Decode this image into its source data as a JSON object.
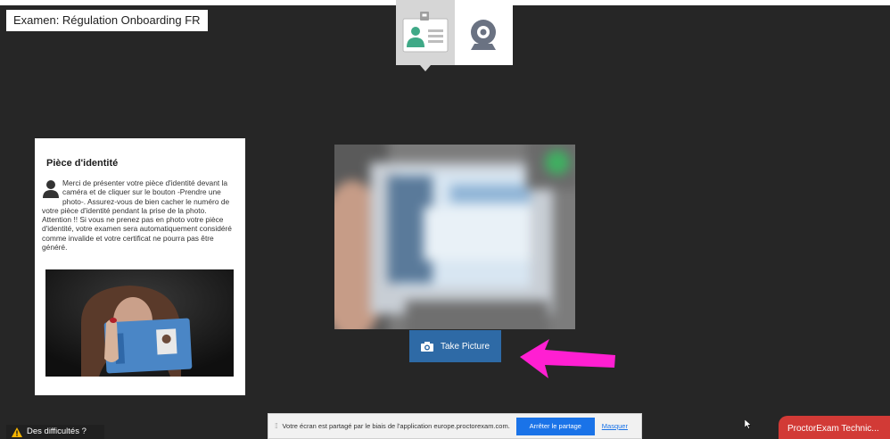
{
  "header": {
    "exam_title": "Examen: Régulation Onboarding FR"
  },
  "steps": [
    {
      "name": "id-card-icon",
      "active": true
    },
    {
      "name": "webcam-icon",
      "active": false
    }
  ],
  "id_card_panel": {
    "title": "Pièce d'identité",
    "instructions": "Merci de présenter votre pièce d'identité devant la caméra et de cliquer sur le bouton -Prendre une photo-. Assurez-vous de bien cacher le numéro de votre pièce d'identité pendant la prise de la photo. Attention !! Si vous ne prenez pas en photo votre pièce d'identité, votre examen sera automatiquement considéré comme invalide et votre certificat ne pourra pas être généré."
  },
  "camera": {
    "take_picture_label": "Take Picture"
  },
  "footer": {
    "difficulties_label": "Des difficultés ?",
    "share_message": "Votre écran est partagé par le biais de l'application europe.proctorexam.com.",
    "stop_share_label": "Arrêter le partage",
    "hide_label": "Masquer",
    "support_label": "ProctorExam Technic..."
  },
  "colors": {
    "background": "#262626",
    "primary_button": "#2e6aa6",
    "annotation_arrow": "#ff1fd2",
    "support_chat": "#d23a36",
    "share_stop": "#1a73e8"
  }
}
